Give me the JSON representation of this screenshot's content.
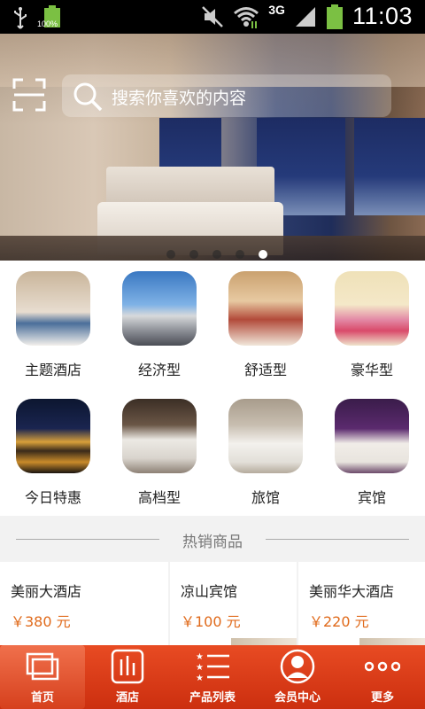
{
  "status_bar": {
    "battery_left_label": "100%",
    "network_type": "3G",
    "time": "11:03"
  },
  "search": {
    "placeholder": "搜索你喜欢的内容"
  },
  "banner": {
    "dot_count": 5,
    "active_dot": 4
  },
  "categories": [
    {
      "label": "主题酒店"
    },
    {
      "label": "经济型"
    },
    {
      "label": "舒适型"
    },
    {
      "label": "豪华型"
    },
    {
      "label": "今日特惠"
    },
    {
      "label": "高档型"
    },
    {
      "label": "旅馆"
    },
    {
      "label": "宾馆"
    }
  ],
  "hot_section": {
    "title": "热销商品"
  },
  "products": [
    {
      "name": "美丽大酒店",
      "price": "￥380 元"
    },
    {
      "name": "凉山宾馆",
      "price": "￥100 元"
    },
    {
      "name": "美丽华大酒店",
      "price": "￥220 元"
    }
  ],
  "tabbar": [
    {
      "label": "首页",
      "icon": "home-icon"
    },
    {
      "label": "酒店",
      "icon": "hotel-icon"
    },
    {
      "label": "产品列表",
      "icon": "list-icon"
    },
    {
      "label": "会员中心",
      "icon": "user-icon"
    },
    {
      "label": "更多",
      "icon": "more-icon"
    }
  ],
  "colors": {
    "accent": "#e04a22",
    "price": "#e06a1b"
  }
}
